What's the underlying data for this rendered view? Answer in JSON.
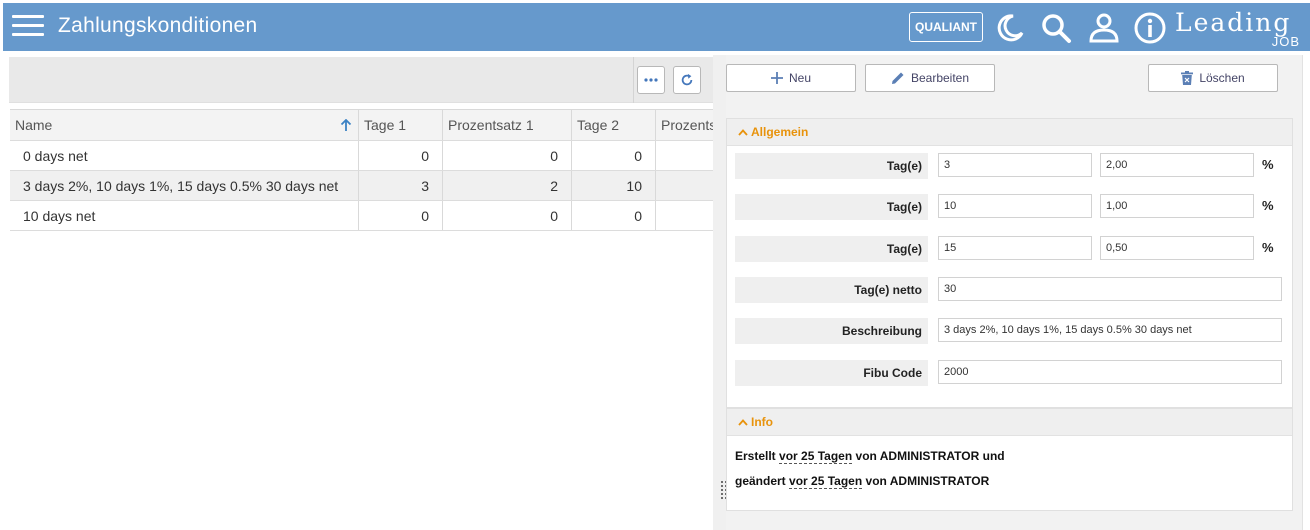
{
  "header": {
    "title": "Zahlungskonditionen",
    "brand_button": "QUALIANT",
    "logo_main": "Leading",
    "logo_sub": "JOB",
    "bg_color": "#6699cc",
    "icons": [
      "menu-icon",
      "moon-icon",
      "search-icon",
      "user-icon",
      "info-icon"
    ]
  },
  "grid": {
    "columns": [
      "Name",
      "Tage 1",
      "Prozentsatz 1",
      "Tage 2",
      "Prozents"
    ],
    "rows": [
      {
        "name": "0 days net",
        "tage1": "0",
        "prozent1": "0",
        "tage2": "0",
        "prozent2": ""
      },
      {
        "name": "3 days 2%, 10 days 1%, 15 days 0.5% 30 days net",
        "tage1": "3",
        "prozent1": "2",
        "tage2": "10",
        "prozent2": ""
      },
      {
        "name": "10 days net",
        "tage1": "0",
        "prozent1": "0",
        "tage2": "0",
        "prozent2": ""
      }
    ]
  },
  "detail_toolbar": {
    "new_label": "Neu",
    "edit_label": "Bearbeiten",
    "delete_label": "Löschen"
  },
  "allgemein": {
    "title": "Allgemein",
    "accent_color": "#e8930c",
    "rows": [
      {
        "label": "Tag(e)",
        "days": "3",
        "percent": "2,00",
        "unit": "%"
      },
      {
        "label": "Tag(e)",
        "days": "10",
        "percent": "1,00",
        "unit": "%"
      },
      {
        "label": "Tag(e)",
        "days": "15",
        "percent": "0,50",
        "unit": "%"
      }
    ],
    "netto_label": "Tag(e) netto",
    "netto_value": "30",
    "beschreibung_label": "Beschreibung",
    "beschreibung_value": "3 days 2%, 10 days 1%, 15 days 0.5% 30 days net",
    "fibu_label": "Fibu Code",
    "fibu_value": "2000"
  },
  "info": {
    "title": "Info",
    "line1_a": "Erstellt",
    "line1_b": "vor 25 Tagen",
    "line1_c": "von ADMINISTRATOR und",
    "line2_a": "geändert",
    "line2_b": "vor 25 Tagen",
    "line2_c": "von ADMINISTRATOR"
  }
}
